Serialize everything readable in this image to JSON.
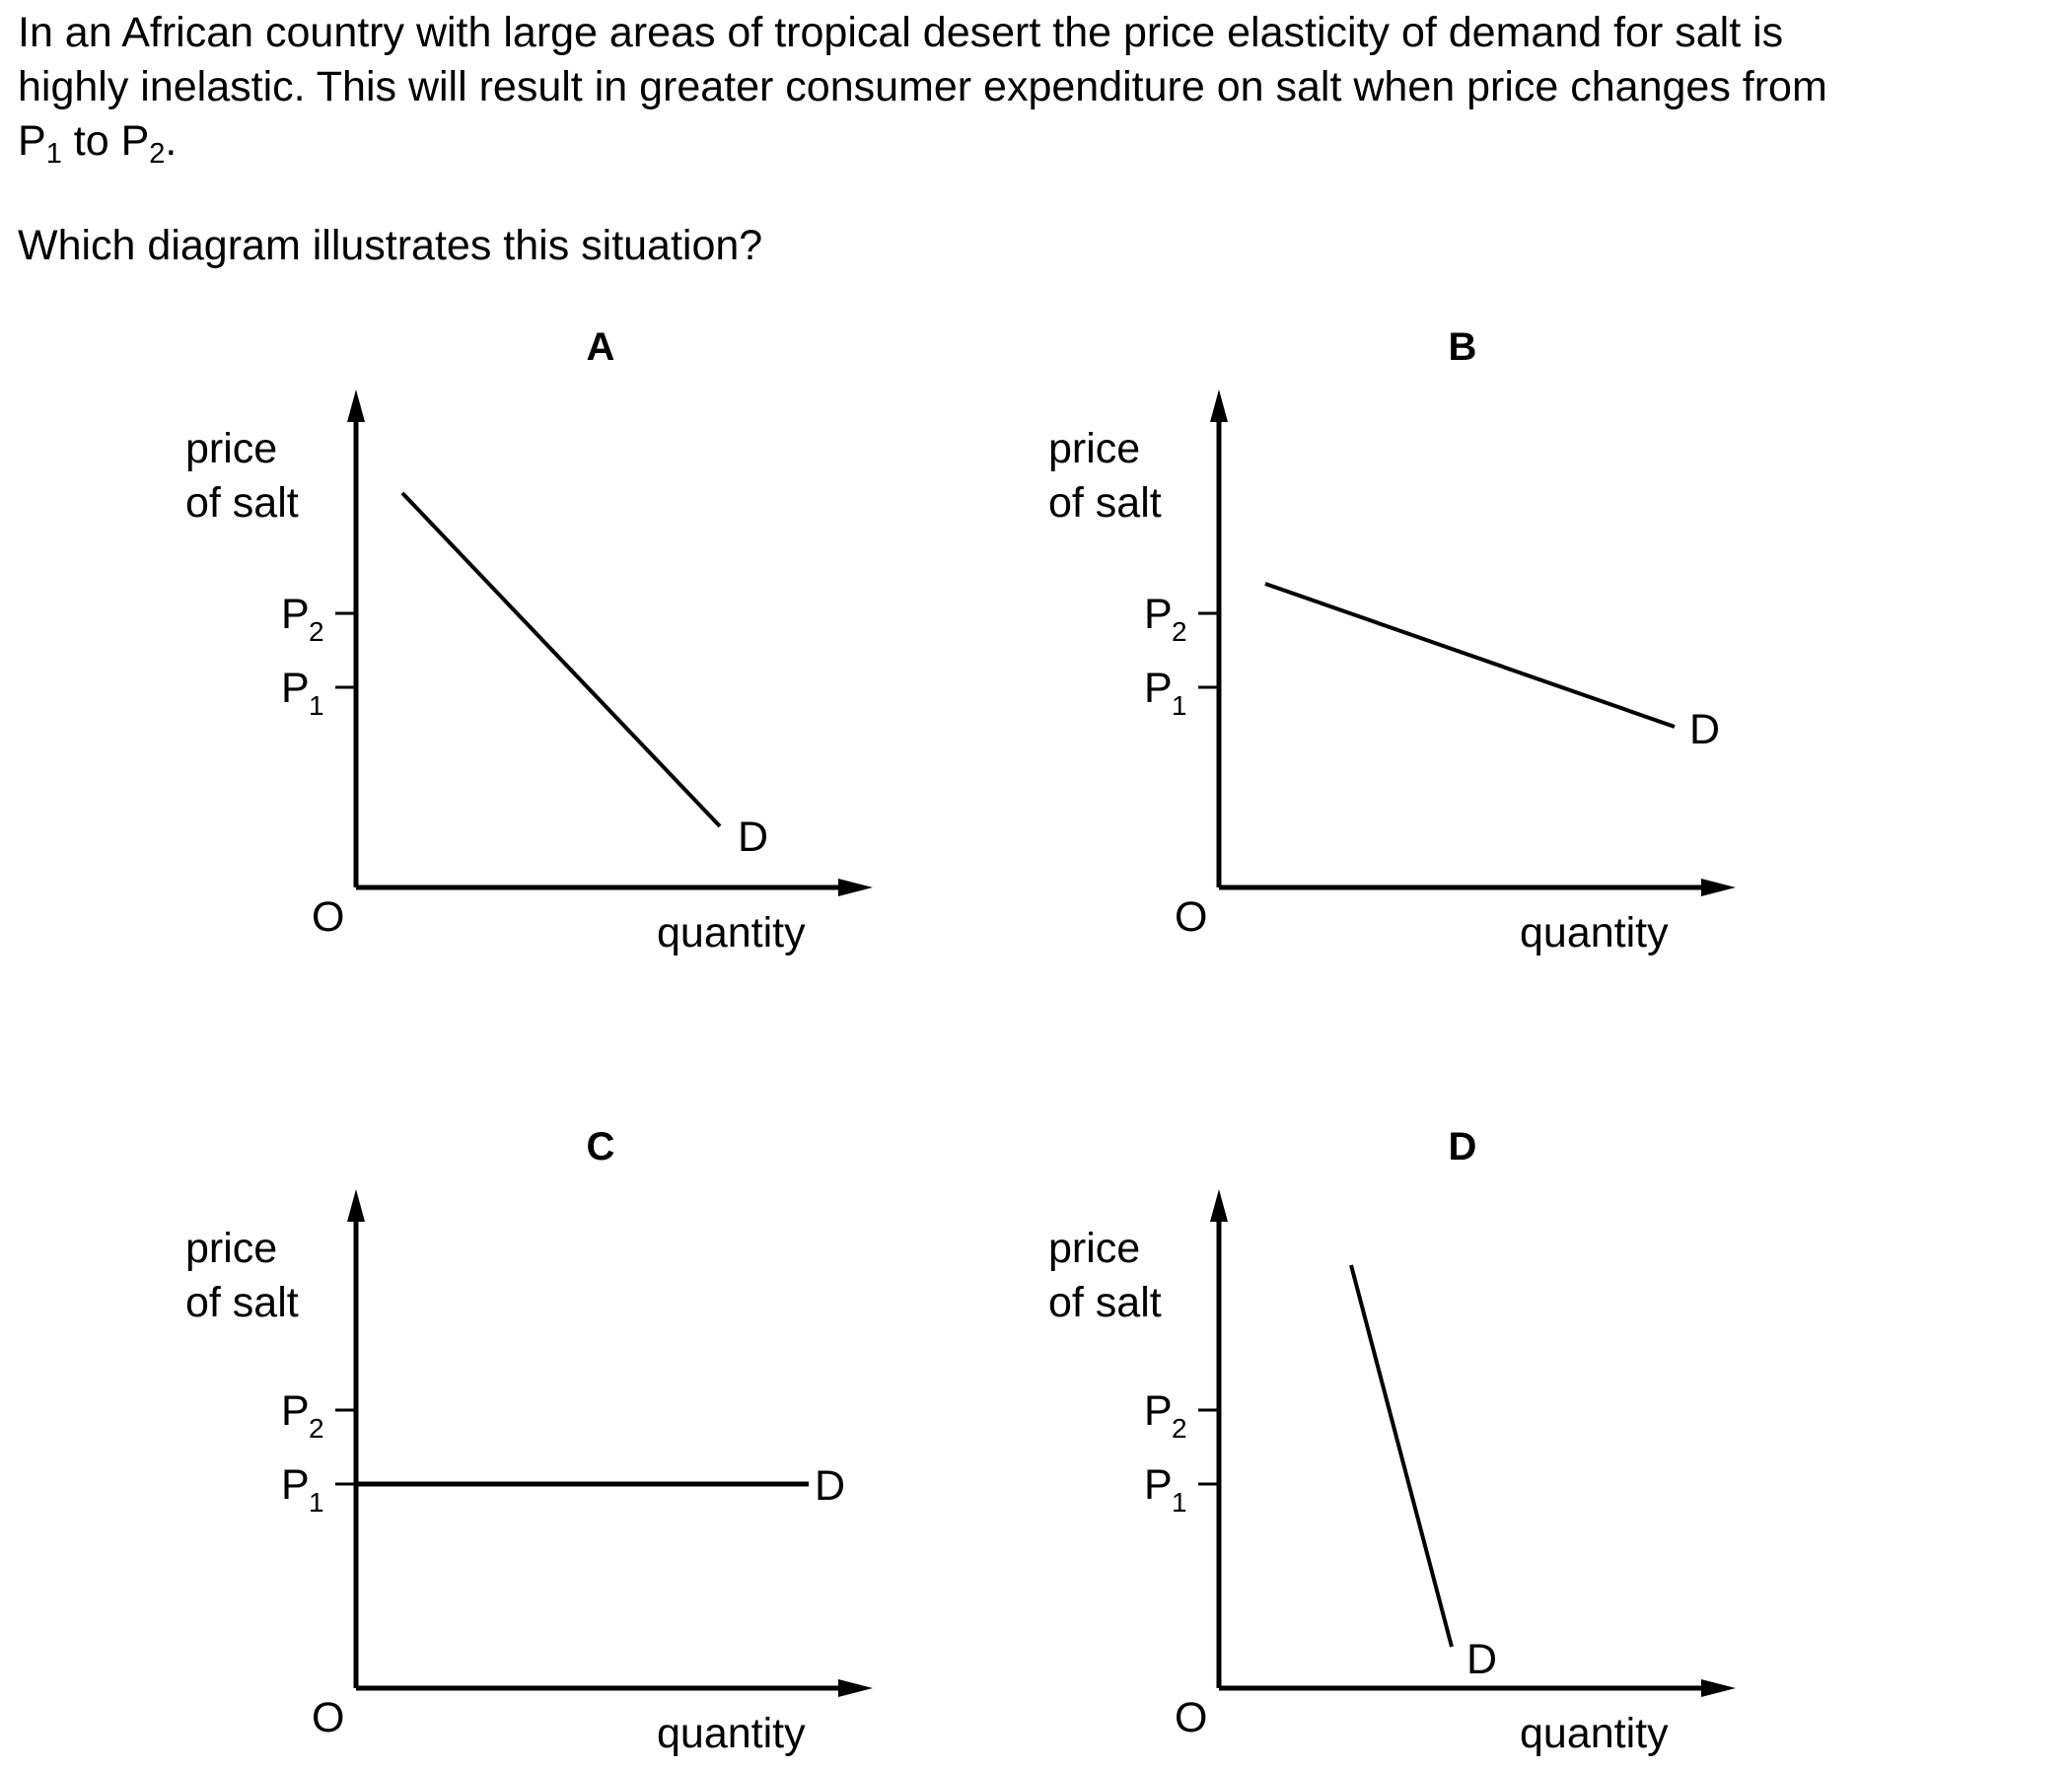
{
  "question": {
    "line1": "In an African country with large areas of tropical desert the price elasticity of demand for salt is",
    "line2": "highly inelastic. This will result in greater consumer expenditure on salt when price changes from",
    "line3_p1": "P",
    "line3_sub1": "1",
    "line3_mid": " to P",
    "line3_sub2": "2",
    "line3_end": ".",
    "prompt": "Which diagram illustrates this situation?"
  },
  "diagrams": [
    {
      "option": "A",
      "y_label_1": "price",
      "y_label_2": "of salt",
      "x_label": "quantity",
      "origin": "O",
      "p2": "P",
      "p2_sub": "2",
      "p1": "P",
      "p1_sub": "1",
      "curve_label": "D",
      "curve_shape": "steep downward sloping"
    },
    {
      "option": "B",
      "y_label_1": "price",
      "y_label_2": "of salt",
      "x_label": "quantity",
      "origin": "O",
      "p2": "P",
      "p2_sub": "2",
      "p1": "P",
      "p1_sub": "1",
      "curve_label": "D",
      "curve_shape": "shallow downward sloping"
    },
    {
      "option": "C",
      "y_label_1": "price",
      "y_label_2": "of salt",
      "x_label": "quantity",
      "origin": "O",
      "p2": "P",
      "p2_sub": "2",
      "p1": "P",
      "p1_sub": "1",
      "curve_label": "D",
      "curve_shape": "horizontal at P1"
    },
    {
      "option": "D",
      "y_label_1": "price",
      "y_label_2": "of salt",
      "x_label": "quantity",
      "origin": "O",
      "p2": "P",
      "p2_sub": "2",
      "p1": "P",
      "p1_sub": "1",
      "curve_label": "D",
      "curve_shape": "very steep downward sloping"
    }
  ]
}
